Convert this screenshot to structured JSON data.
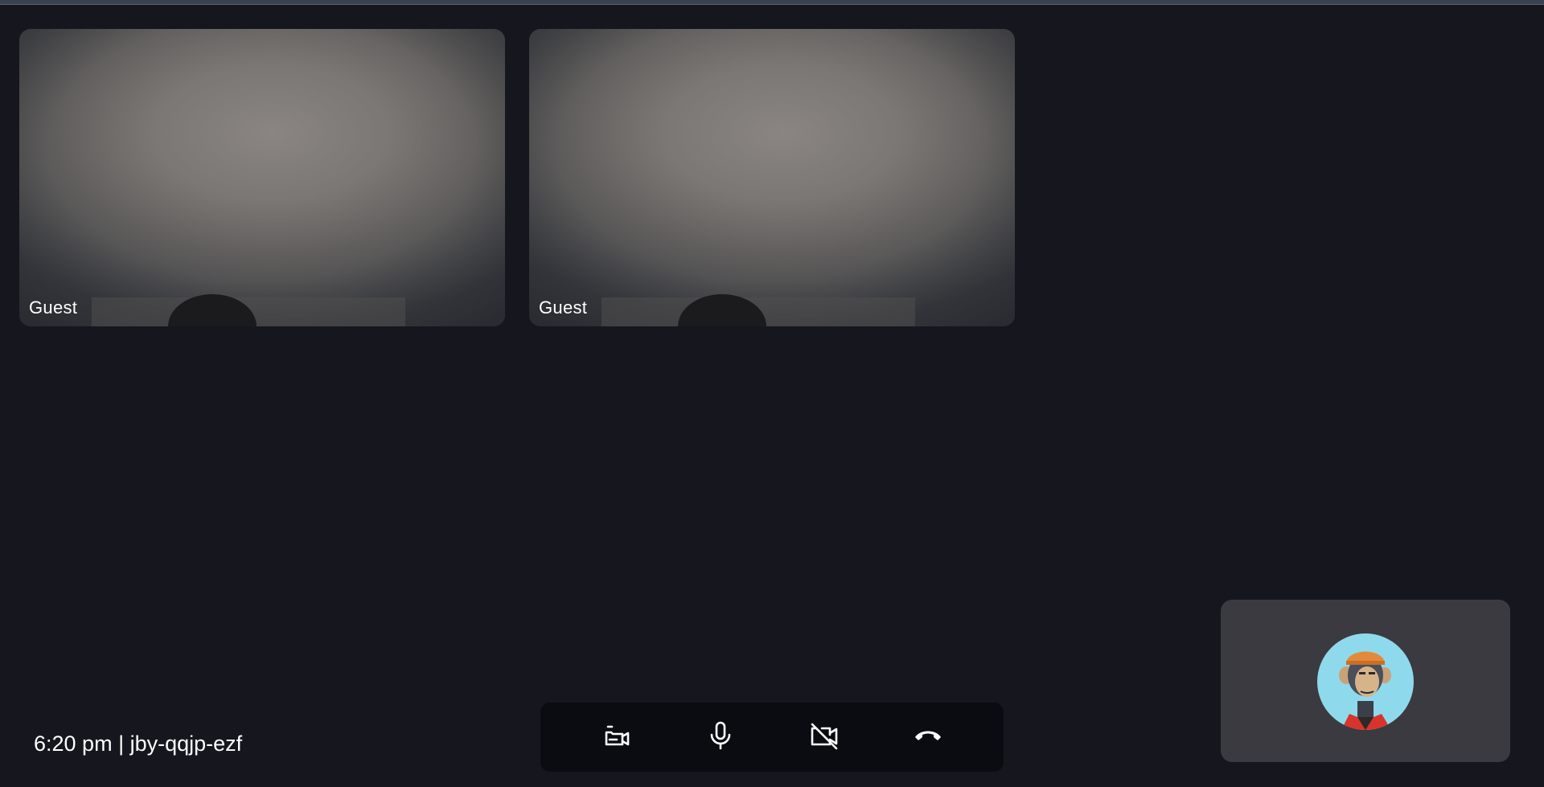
{
  "participants": [
    {
      "name": "Guest"
    },
    {
      "name": "Guest"
    }
  ],
  "footer": {
    "time": "6:20 pm",
    "separator": "|",
    "meeting_code": "jby-qqjp-ezf"
  },
  "controls": [
    {
      "icon": "switch-camera-icon"
    },
    {
      "icon": "microphone-icon"
    },
    {
      "icon": "camera-off-icon"
    },
    {
      "icon": "end-call-icon"
    }
  ],
  "colors": {
    "background": "#15161e",
    "control_bar": "#0a0c12",
    "self_view": "#3a3a40",
    "avatar_bg": "#8fd9ec",
    "text": "#ffffff"
  }
}
